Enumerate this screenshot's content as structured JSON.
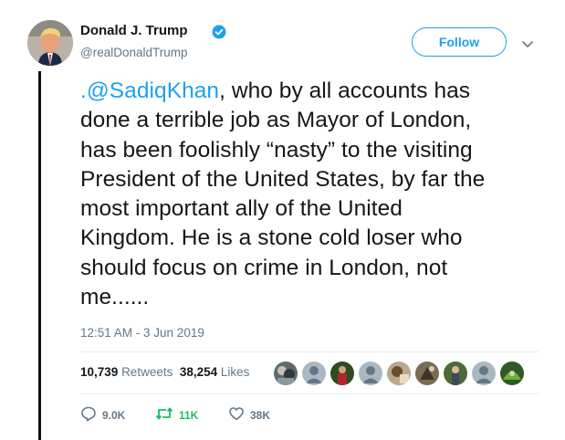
{
  "user": {
    "display_name": "Donald J. Trump",
    "handle": "@realDonaldTrump",
    "verified": true
  },
  "header": {
    "follow_label": "Follow"
  },
  "tweet": {
    "mention": ".@SadiqKhan",
    "lines": [
      ", who by all accounts has",
      "done a terrible job as Mayor of London,",
      "has been foolishly “nasty” to the visiting",
      "President of the United States, by far the",
      "most important ally of the United",
      "Kingdom. He is a stone cold loser who",
      "should focus on crime in London, not",
      "me......"
    ],
    "timestamp": "12:51 AM - 3 Jun 2019"
  },
  "stats": {
    "retweets_count": "10,739",
    "retweets_label": "Retweets",
    "likes_count": "38,254",
    "likes_label": "Likes"
  },
  "likers": [
    {
      "icon": "photo-avatar"
    },
    {
      "icon": "default-egg-avatar"
    },
    {
      "icon": "photo-avatar"
    },
    {
      "icon": "default-egg-avatar"
    },
    {
      "icon": "photo-avatar"
    },
    {
      "icon": "photo-avatar"
    },
    {
      "icon": "photo-avatar"
    },
    {
      "icon": "default-egg-avatar"
    },
    {
      "icon": "photo-avatar"
    }
  ],
  "actions": {
    "reply_count": "9.0K",
    "retweet_count": "11K",
    "like_count": "38K"
  },
  "colors": {
    "accent": "#1da1f2",
    "secondary_text": "#657786",
    "retweet_green": "#17bf63",
    "divider": "#e6ecf0"
  }
}
